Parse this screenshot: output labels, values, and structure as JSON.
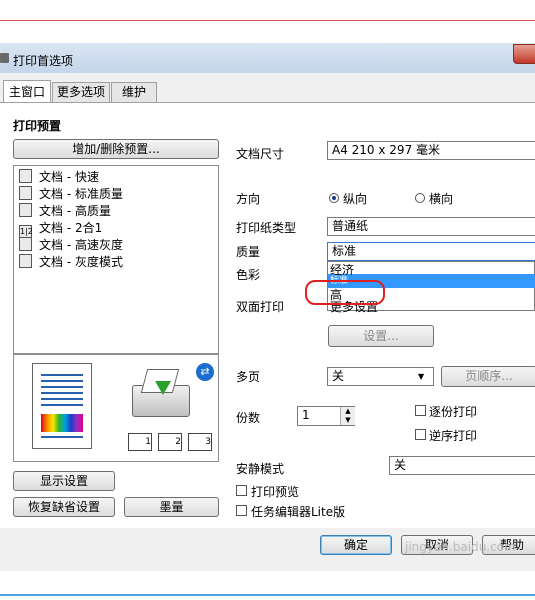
{
  "window": {
    "title": "打印首选项"
  },
  "tabs": [
    {
      "label": "主窗口"
    },
    {
      "label": "更多选项"
    },
    {
      "label": "维护"
    }
  ],
  "presets": {
    "title": "打印预置",
    "add_remove_button": "增加/删除预置...",
    "items": [
      {
        "label": "文档 - 快速"
      },
      {
        "label": "文档 - 标准质量"
      },
      {
        "label": "文档 - 高质量"
      },
      {
        "label": "文档 - 2合1"
      },
      {
        "label": "文档 - 高速灰度"
      },
      {
        "label": "文档 - 灰度模式"
      }
    ]
  },
  "settings": {
    "paper_size_label": "文档尺寸",
    "paper_size_value": "A4 210 x 297 毫米",
    "orientation_label": "方向",
    "orientation_portrait": "纵向",
    "orientation_landscape": "横向",
    "paper_type_label": "打印纸类型",
    "paper_type_value": "普通纸",
    "quality_label": "质量",
    "quality_value": "标准",
    "quality_options": [
      "经济",
      "标准",
      "高",
      "更多设置"
    ],
    "color_label": "色彩",
    "duplex_label": "双面打印",
    "settings_button": "设置...",
    "multipage_label": "多页",
    "multipage_value": "关",
    "page_order_button": "页顺序...",
    "copies_label": "份数",
    "copies_value": "1",
    "collate_label": "逐份打印",
    "reverse_label": "逆序打印",
    "quiet_mode_label": "安静模式",
    "quiet_mode_value": "关",
    "print_preview_label": "打印预览",
    "job_arranger_label": "任务编辑器Lite版"
  },
  "bottom_left": {
    "show_settings": "显示设置",
    "restore_defaults": "恢复缺省设置",
    "overlay": "墨量"
  },
  "footer": {
    "ok": "确定",
    "cancel": "取消",
    "help": "帮助"
  },
  "watermark": "jingyan.baidu.com",
  "colors": {
    "highlight": "#3399ff",
    "annotation": "#e02020"
  }
}
